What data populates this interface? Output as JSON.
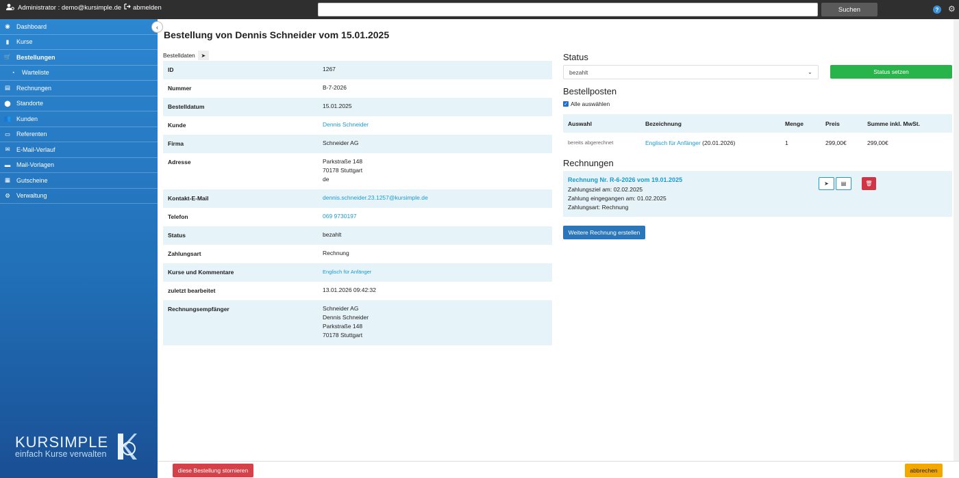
{
  "topbar": {
    "user_label": "Administrator : demo@kursimple.de",
    "logout_label": "abmelden",
    "search_placeholder": "",
    "search_button": "Suchen",
    "help_label": "?"
  },
  "sidebar": {
    "items": [
      {
        "label": "Dashboard",
        "icon": "dashboard-icon"
      },
      {
        "label": "Kurse",
        "icon": "book-icon"
      },
      {
        "label": "Bestellungen",
        "icon": "cart-icon",
        "active": true
      },
      {
        "label": "Warteliste",
        "icon": "clock-icon",
        "sub": true
      },
      {
        "label": "Rechnungen",
        "icon": "invoice-icon"
      },
      {
        "label": "Standorte",
        "icon": "map-pin-icon"
      },
      {
        "label": "Kunden",
        "icon": "users-icon"
      },
      {
        "label": "Referenten",
        "icon": "presenter-icon"
      },
      {
        "label": "E-Mail-Verlauf",
        "icon": "envelope-icon"
      },
      {
        "label": "Mail-Vorlagen",
        "icon": "mail-template-icon"
      },
      {
        "label": "Gutscheine",
        "icon": "gift-icon"
      },
      {
        "label": "Verwaltung",
        "icon": "gear-icon"
      }
    ],
    "logo_brand": "KURSIMPLE",
    "logo_tagline": "einfach Kurse verwalten"
  },
  "page": {
    "title": "Bestellung von Dennis Schneider vom 15.01.2025",
    "tab_label": "Bestelldaten"
  },
  "details": [
    {
      "key": "ID",
      "value": "1267"
    },
    {
      "key": "Nummer",
      "value": "B-7-2026"
    },
    {
      "key": "Bestelldatum",
      "value": "15.01.2025"
    },
    {
      "key": "Kunde",
      "value": "Dennis Schneider",
      "link": true
    },
    {
      "key": "Firma",
      "value": "Schneider AG"
    },
    {
      "key": "Adresse",
      "lines": [
        "Parkstraße 148",
        "70178 Stuttgart",
        "de"
      ]
    },
    {
      "key": "Kontakt-E-Mail",
      "value": "dennis.schneider.23.1257@kursimple.de",
      "link": true
    },
    {
      "key": "Telefon",
      "value": "069 9730197",
      "link": true
    },
    {
      "key": "Status",
      "value": "bezahlt"
    },
    {
      "key": "Zahlungsart",
      "value": "Rechnung"
    },
    {
      "key": "Kurse und Kommentare",
      "value": "Englisch für Anfänger",
      "small_link": true
    },
    {
      "key": "zuletzt bearbeitet",
      "value": "13.01.2026 09:42:32"
    },
    {
      "key": "Rechnungsempfänger",
      "lines": [
        "Schneider AG",
        "Dennis Schneider",
        "Parkstraße 148",
        "70178 Stuttgart"
      ]
    }
  ],
  "status": {
    "heading": "Status",
    "selected": "bezahlt",
    "set_button": "Status setzen"
  },
  "bestellposten": {
    "heading": "Bestellposten",
    "select_all": "Alle auswählen",
    "columns": [
      "Auswahl",
      "Bezeichnung",
      "Menge",
      "Preis",
      "Summe inkl. MwSt."
    ],
    "rows": [
      {
        "auswahl": "bereits abgerechnet",
        "bezeichnung_link": "Englisch für Anfänger",
        "bezeichnung_suffix": " (20.01.2026)",
        "menge": "1",
        "preis": "299,00€",
        "summe": "299,00€"
      }
    ]
  },
  "rechnungen": {
    "heading": "Rechnungen",
    "invoice": {
      "title": "Rechnung Nr. R-6-2026 vom 19.01.2025",
      "zahlungsziel": "Zahlungsziel am: 02.02.2025",
      "eingegangen": "Zahlung eingegangen am: 01.02.2025",
      "zahlungsart": "Zahlungsart: Rechnung"
    },
    "more_button": "Weitere Rechnung erstellen"
  },
  "footer": {
    "cancel_order": "diese Bestellung stornieren",
    "abort": "abbrechen"
  },
  "colors": {
    "sidebar_top": "#2c86d0",
    "sidebar_bottom": "#1a4f94",
    "accent_link": "#1a9ad0",
    "success": "#28b44a",
    "danger": "#d03545",
    "warning": "#f3a800",
    "row_highlight": "#e6f3f8"
  }
}
